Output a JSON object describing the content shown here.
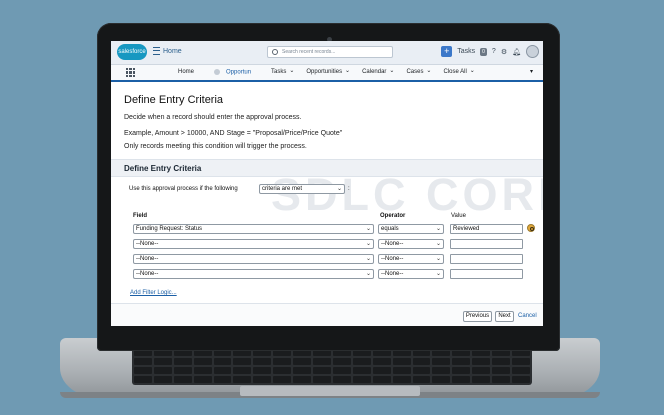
{
  "header": {
    "logo_text": "salesforce",
    "home_label": "Home",
    "search_placeholder": "Search recent records...",
    "tasks_label": "Tasks",
    "tasks_count": "0"
  },
  "nav": {
    "items": [
      "Home",
      "Opportun",
      "Tasks",
      "Opportunities",
      "Calendar",
      "Cases",
      "Close All"
    ]
  },
  "page": {
    "title": "Define Entry Criteria",
    "desc1": "Decide when a record should enter the approval process.",
    "desc2": "Example, Amount > 10000, AND Stage = \"Proposal/Price/Price Quote\"",
    "desc3": "Only records meeting this condition will trigger the process."
  },
  "section": {
    "title": "Define Entry Criteria",
    "use_label": "Use this approval process if the following",
    "criteria_value": "criteria are met",
    "colon": ":"
  },
  "watermark": "SDLC CORP",
  "columns": {
    "field": "Field",
    "operator": "Operator",
    "value": "Value"
  },
  "rows": [
    {
      "field": "Funding Request: Status",
      "operator": "equals",
      "value": "Reviewed"
    },
    {
      "field": "--None--",
      "operator": "--None--",
      "value": ""
    },
    {
      "field": "--None--",
      "operator": "--None--",
      "value": ""
    },
    {
      "field": "--None--",
      "operator": "--None--",
      "value": ""
    }
  ],
  "filter_logic_link": "Add Filter Logic...",
  "footer": {
    "previous": "Previous",
    "next": "Next",
    "cancel": "Cancel"
  },
  "colors": {
    "accent": "#1b5fa6",
    "background": "#6f9ab3"
  }
}
